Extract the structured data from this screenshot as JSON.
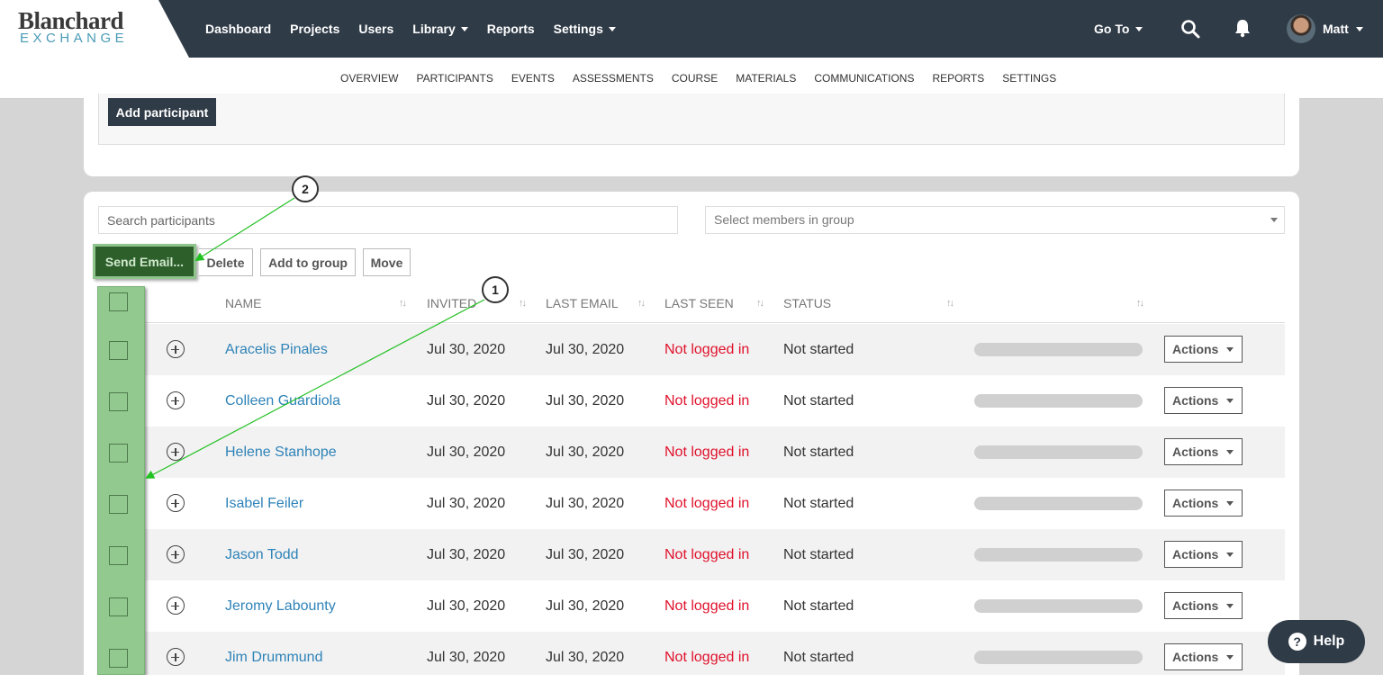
{
  "brand": {
    "name": "Blanchard",
    "sub": "EXCHANGE"
  },
  "nav": {
    "items": [
      {
        "label": "Dashboard",
        "dropdown": false
      },
      {
        "label": "Projects",
        "dropdown": false
      },
      {
        "label": "Users",
        "dropdown": false
      },
      {
        "label": "Library",
        "dropdown": true
      },
      {
        "label": "Reports",
        "dropdown": false
      },
      {
        "label": "Settings",
        "dropdown": true
      }
    ],
    "goto": "Go To",
    "user": "Matt"
  },
  "subnav": {
    "items": [
      "OVERVIEW",
      "PARTICIPANTS",
      "EVENTS",
      "ASSESSMENTS",
      "COURSE",
      "MATERIALS",
      "COMMUNICATIONS",
      "REPORTS",
      "SETTINGS"
    ],
    "active": "PARTICIPANTS"
  },
  "add_participant": "Add participant",
  "search": {
    "placeholder": "Search participants"
  },
  "group_select": {
    "placeholder": "Select members in group"
  },
  "toolbar": {
    "send_email": "Send Email...",
    "delete": "Delete",
    "add_to_group": "Add to group",
    "move": "Move"
  },
  "table": {
    "headers": {
      "name": "NAME",
      "invited": "INVITED",
      "last_email": "LAST EMAIL",
      "last_seen": "LAST SEEN",
      "status": "STATUS"
    },
    "actions_label": "Actions",
    "rows": [
      {
        "name": "Aracelis Pinales",
        "invited": "Jul 30, 2020",
        "last_email": "Jul 30, 2020",
        "last_seen": "Not logged in",
        "status": "Not started"
      },
      {
        "name": "Colleen Guardiola",
        "invited": "Jul 30, 2020",
        "last_email": "Jul 30, 2020",
        "last_seen": "Not logged in",
        "status": "Not started"
      },
      {
        "name": "Helene Stanhope",
        "invited": "Jul 30, 2020",
        "last_email": "Jul 30, 2020",
        "last_seen": "Not logged in",
        "status": "Not started"
      },
      {
        "name": "Isabel Feiler",
        "invited": "Jul 30, 2020",
        "last_email": "Jul 30, 2020",
        "last_seen": "Not logged in",
        "status": "Not started"
      },
      {
        "name": "Jason Todd",
        "invited": "Jul 30, 2020",
        "last_email": "Jul 30, 2020",
        "last_seen": "Not logged in",
        "status": "Not started"
      },
      {
        "name": "Jeromy Labounty",
        "invited": "Jul 30, 2020",
        "last_email": "Jul 30, 2020",
        "last_seen": "Not logged in",
        "status": "Not started"
      },
      {
        "name": "Jim Drummund",
        "invited": "Jul 30, 2020",
        "last_email": "Jul 30, 2020",
        "last_seen": "Not logged in",
        "status": "Not started"
      }
    ]
  },
  "annotations": {
    "step1": "1",
    "step2": "2"
  },
  "help": {
    "label": "Help",
    "icon": "?"
  },
  "colors": {
    "topbar": "#2f3b47",
    "link": "#2e83b8",
    "not_logged_in": "#e0112b",
    "highlight": "#92c98f",
    "arrow": "#22c122"
  }
}
